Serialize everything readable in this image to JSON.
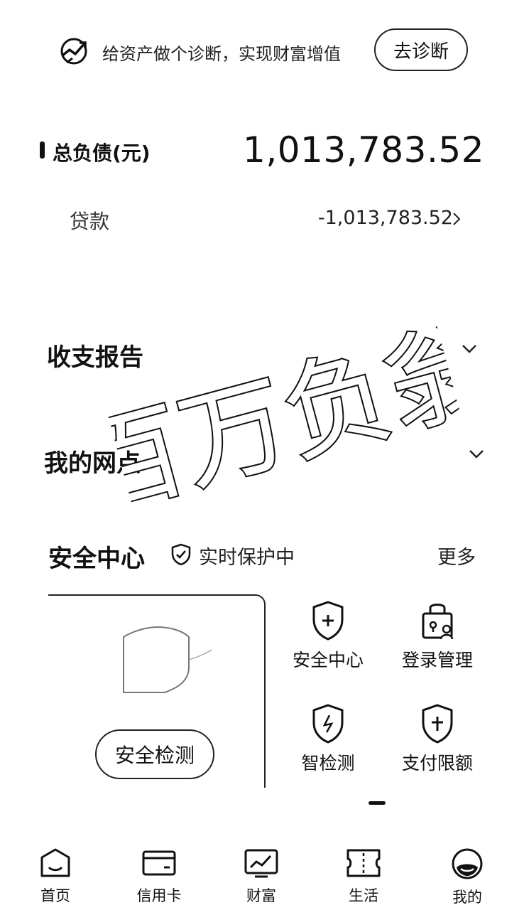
{
  "banner": {
    "text": "给资产做个诊断，实现财富增值",
    "button": "去诊断",
    "icon": "diagnosis-chart-icon"
  },
  "debt": {
    "label": "总负债(元)",
    "value": "1,013,783.52"
  },
  "loan": {
    "label": "贷款",
    "value": "-1,013,783.52"
  },
  "sections": [
    {
      "title": "收支报告"
    },
    {
      "title": "我的网点"
    }
  ],
  "security": {
    "title": "安全中心",
    "status": "实时保护中",
    "more": "更多",
    "check_button": "安全检测",
    "items": [
      {
        "label": "安全中心",
        "icon": "shield-plus-icon"
      },
      {
        "label": "登录管理",
        "icon": "lock-user-icon"
      },
      {
        "label": "智检测",
        "icon": "shield-check-icon"
      },
      {
        "label": "支付限额",
        "icon": "shield-limit-icon"
      }
    ]
  },
  "tabs": [
    {
      "label": "首页",
      "icon": "home-icon"
    },
    {
      "label": "信用卡",
      "icon": "credit-card-icon"
    },
    {
      "label": "财富",
      "icon": "wealth-chart-icon"
    },
    {
      "label": "生活",
      "icon": "ticket-icon"
    },
    {
      "label": "我的",
      "icon": "profile-icon"
    }
  ],
  "watermark": "百万负翁"
}
